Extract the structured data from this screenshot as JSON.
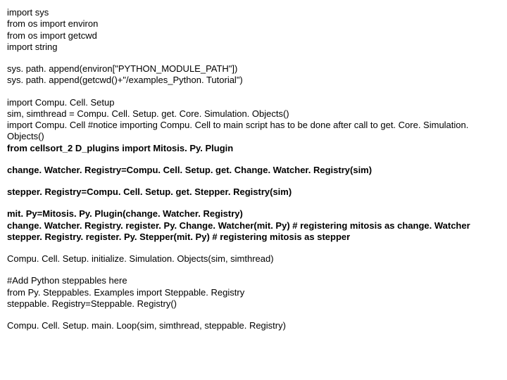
{
  "lines": [
    {
      "text": "import sys",
      "bold": false
    },
    {
      "text": "from os import environ",
      "bold": false
    },
    {
      "text": "from os import getcwd",
      "bold": false
    },
    {
      "text": "import string",
      "bold": false
    },
    {
      "text": "",
      "bold": false
    },
    {
      "text": "sys. path. append(environ[\"PYTHON_MODULE_PATH\"])",
      "bold": false
    },
    {
      "text": "sys. path. append(getcwd()+\"/examples_Python. Tutorial\")",
      "bold": false
    },
    {
      "text": "",
      "bold": false
    },
    {
      "text": "import Compu. Cell. Setup",
      "bold": false
    },
    {
      "text": "sim, simthread = Compu. Cell. Setup. get. Core. Simulation. Objects()",
      "bold": false
    },
    {
      "text": "import Compu. Cell #notice importing Compu. Cell to main script has to be done after call to get. Core. Simulation. Objects()",
      "bold": false
    },
    {
      "text": "from cellsort_2 D_plugins import Mitosis. Py. Plugin",
      "bold": true
    },
    {
      "text": "",
      "bold": false
    },
    {
      "text": "change. Watcher. Registry=Compu. Cell. Setup. get. Change. Watcher. Registry(sim)",
      "bold": true
    },
    {
      "text": "",
      "bold": false
    },
    {
      "text": "stepper. Registry=Compu. Cell. Setup. get. Stepper. Registry(sim)",
      "bold": true
    },
    {
      "text": "",
      "bold": false
    },
    {
      "text": "mit. Py=Mitosis. Py. Plugin(change. Watcher. Registry)",
      "bold": true
    },
    {
      "text": "change. Watcher. Registry. register. Py. Change. Watcher(mit. Py) # registering mitosis as change. Watcher",
      "bold": true
    },
    {
      "text": "stepper. Registry. register. Py. Stepper(mit. Py) # registering mitosis as stepper",
      "bold": true
    },
    {
      "text": "",
      "bold": false
    },
    {
      "text": "Compu. Cell. Setup. initialize. Simulation. Objects(sim, simthread)",
      "bold": false
    },
    {
      "text": "",
      "bold": false
    },
    {
      "text": "#Add Python steppables here",
      "bold": false
    },
    {
      "text": "from Py. Steppables. Examples import Steppable. Registry",
      "bold": false
    },
    {
      "text": "steppable. Registry=Steppable. Registry()",
      "bold": false
    },
    {
      "text": "",
      "bold": false
    },
    {
      "text": "Compu. Cell. Setup. main. Loop(sim, simthread, steppable. Registry)",
      "bold": false
    }
  ]
}
